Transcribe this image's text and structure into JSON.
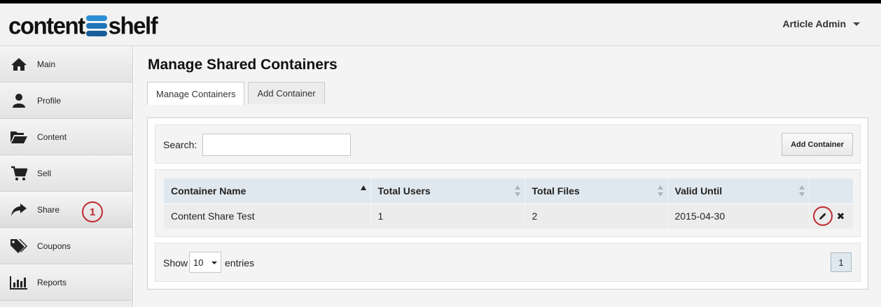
{
  "app": {
    "logo_left": "content",
    "logo_right": "shelf",
    "user_name": "Article Admin"
  },
  "sidebar": {
    "items": [
      {
        "label": "Main",
        "icon": "home-icon"
      },
      {
        "label": "Profile",
        "icon": "user-icon"
      },
      {
        "label": "Content",
        "icon": "folder-open-icon"
      },
      {
        "label": "Sell",
        "icon": "cart-icon"
      },
      {
        "label": "Share",
        "icon": "share-icon"
      },
      {
        "label": "Coupons",
        "icon": "tags-icon"
      },
      {
        "label": "Reports",
        "icon": "bar-chart-icon"
      }
    ],
    "active_item": "Share",
    "step_badge": "1"
  },
  "main": {
    "title": "Manage Shared Containers",
    "tabs": [
      {
        "label": "Manage Containers",
        "active": true
      },
      {
        "label": "Add Container",
        "active": false
      }
    ],
    "search": {
      "label": "Search:",
      "value": "",
      "placeholder": ""
    },
    "add_button_label": "Add Container",
    "table": {
      "columns": [
        "Container Name",
        "Total Users",
        "Total Files",
        "Valid Until"
      ],
      "sorted_column": "Container Name",
      "sort_direction": "ascending",
      "rows": [
        {
          "name": "Content Share Test",
          "users": "1",
          "files": "2",
          "valid_until": "2015-04-30"
        }
      ]
    },
    "pagination": {
      "show_label": "Show",
      "entries_value": "10",
      "entries_label": "entries",
      "current_page": "1"
    }
  },
  "colors": {
    "accent_red": "#c0282d",
    "header_blue": "#dfe8ee",
    "logo_blue": "#1f73b8"
  }
}
